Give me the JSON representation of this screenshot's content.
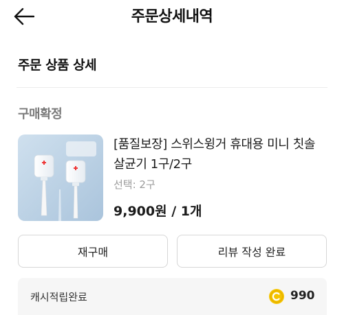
{
  "header": {
    "title": "주문상세내역",
    "back_icon": "arrow-left-icon"
  },
  "section": {
    "title": "주문 상품 상세"
  },
  "order": {
    "status": "구매확정",
    "product": {
      "name": "[품질보장] 스위스윙거 휴대용 미니 칫솔 살균기 1구/2구",
      "option": "선택: 2구",
      "price": "9,900원 / 1개",
      "thumbnail_icon": "product-thumbnail-image"
    },
    "buttons": {
      "rebuy": "재구매",
      "review": "리뷰 작성 완료"
    },
    "cash": {
      "label": "캐시적립완료",
      "amount": "990",
      "coin_color": "#f5c400",
      "coin_icon": "cash-coin-icon"
    }
  }
}
